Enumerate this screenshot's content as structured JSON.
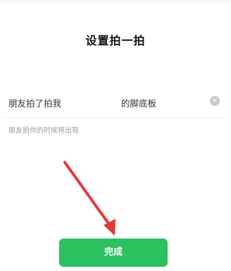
{
  "page": {
    "title": "设置拍一拍"
  },
  "nudge_field": {
    "prefix": "朋友拍了拍我",
    "value": "的脚底板",
    "clear_icon": "×"
  },
  "hint": "朋友拍你的时候将出现",
  "done_button": "完成",
  "colors": {
    "accent": "#2bc15f",
    "arrow": "#e53935"
  }
}
